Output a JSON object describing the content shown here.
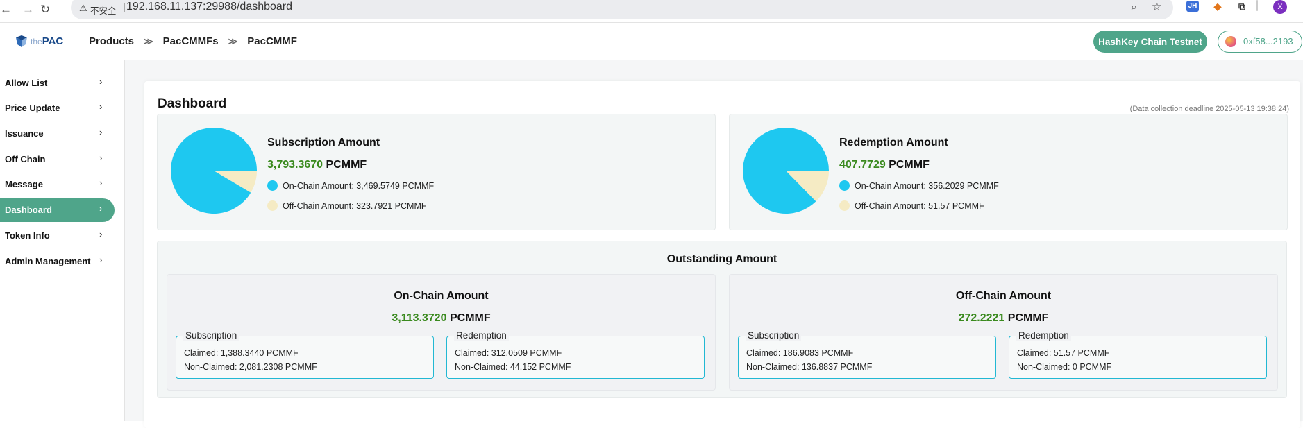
{
  "browser": {
    "security_label": "不安全",
    "url": "192.168.11.137:29988/dashboard",
    "ext_jh": "JH",
    "profile_initial": "X"
  },
  "header": {
    "logo_prefix": "the",
    "logo_text": "PAC",
    "breadcrumb": [
      "Products",
      "PacCMMFs",
      "PacCMMF"
    ],
    "breadcrumb_separator": "≫",
    "network_label": "HashKey Chain Testnet",
    "wallet_address": "0xf58...2193"
  },
  "sidebar": {
    "items": [
      {
        "label": "Allow List",
        "active": false
      },
      {
        "label": "Price Update",
        "active": false
      },
      {
        "label": "Issuance",
        "active": false
      },
      {
        "label": "Off Chain",
        "active": false
      },
      {
        "label": "Message",
        "active": false
      },
      {
        "label": "Dashboard",
        "active": true
      },
      {
        "label": "Token Info",
        "active": false
      },
      {
        "label": "Admin Management",
        "active": false
      }
    ],
    "chevron": "›"
  },
  "main": {
    "title": "Dashboard",
    "deadline": "(Data collection deadline 2025-05-13 19:38:24)",
    "subscription": {
      "title": "Subscription Amount",
      "amount": "3,793.3670",
      "unit": "PCMMF",
      "on_chain_label": "On-Chain Amount: 3,469.5749 PCMMF",
      "off_chain_label": "Off-Chain Amount: 323.7921 PCMMF",
      "pie": {
        "on_chain": 3469.5749,
        "off_chain": 323.7921
      }
    },
    "redemption": {
      "title": "Redemption Amount",
      "amount": "407.7729",
      "unit": "PCMMF",
      "on_chain_label": "On-Chain Amount: 356.2029 PCMMF",
      "off_chain_label": "Off-Chain Amount: 51.57 PCMMF",
      "pie": {
        "on_chain": 356.2029,
        "off_chain": 51.57
      }
    },
    "outstanding": {
      "title": "Outstanding Amount",
      "on_chain": {
        "title": "On-Chain Amount",
        "amount": "3,113.3720",
        "unit": "PCMMF",
        "subscription": {
          "legend": "Subscription",
          "claimed": "Claimed: 1,388.3440 PCMMF",
          "non_claimed": "Non-Claimed: 2,081.2308 PCMMF"
        },
        "redemption": {
          "legend": "Redemption",
          "claimed": "Claimed: 312.0509 PCMMF",
          "non_claimed": "Non-Claimed: 44.152 PCMMF"
        }
      },
      "off_chain": {
        "title": "Off-Chain Amount",
        "amount": "272.2221",
        "unit": "PCMMF",
        "subscription": {
          "legend": "Subscription",
          "claimed": "Claimed: 186.9083 PCMMF",
          "non_claimed": "Non-Claimed: 136.8837 PCMMF"
        },
        "redemption": {
          "legend": "Redemption",
          "claimed": "Claimed: 51.57 PCMMF",
          "non_claimed": "Non-Claimed: 0 PCMMF"
        }
      }
    }
  },
  "colors": {
    "accent": "#4fa58a",
    "on_chain": "#1ec8f0",
    "off_chain": "#f5ebc4",
    "amount_green": "#3a8a1e",
    "fieldset_border": "#22b8d3"
  }
}
